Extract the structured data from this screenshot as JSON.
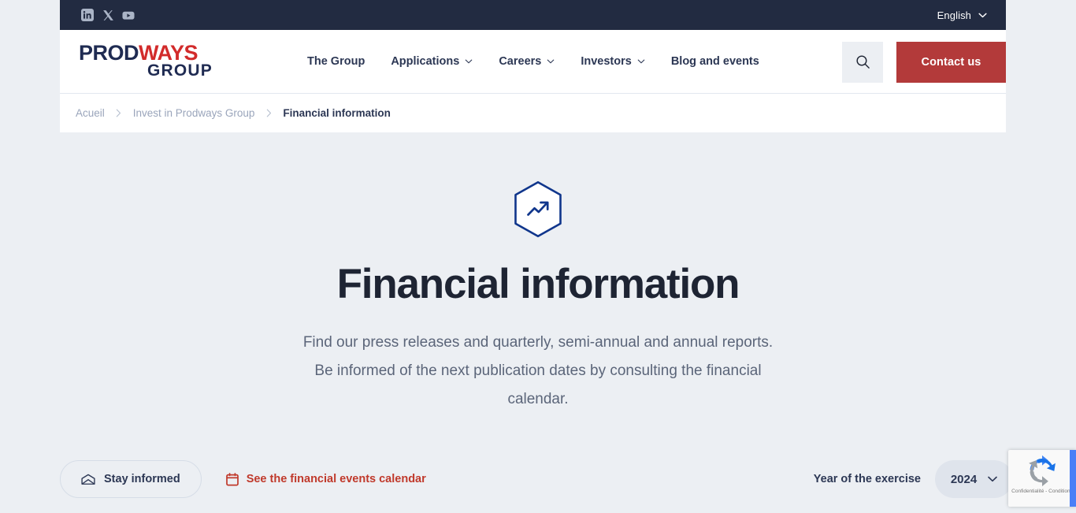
{
  "topbar": {
    "social": [
      {
        "name": "linkedin-icon",
        "label": "LinkedIn"
      },
      {
        "name": "x-twitter-icon",
        "label": "X"
      },
      {
        "name": "youtube-icon",
        "label": "YouTube"
      }
    ],
    "language": "English"
  },
  "header": {
    "logo": {
      "part1": "PROD",
      "part2": "WAYS",
      "part3": "GROUP"
    },
    "nav": [
      {
        "label": "The Group",
        "has_dropdown": false
      },
      {
        "label": "Applications",
        "has_dropdown": true
      },
      {
        "label": "Careers",
        "has_dropdown": true
      },
      {
        "label": "Investors",
        "has_dropdown": true
      },
      {
        "label": "Blog and events",
        "has_dropdown": false
      }
    ],
    "search_icon": "search-icon",
    "contact_label": "Contact us"
  },
  "breadcrumb": {
    "items": [
      {
        "label": "Acueil",
        "current": false
      },
      {
        "label": "Invest in Prodways Group",
        "current": false
      },
      {
        "label": "Financial information",
        "current": true
      }
    ]
  },
  "hero": {
    "icon": "trending-up-hexagon-icon",
    "title": "Financial information",
    "description": "Find our press releases and quarterly, semi-annual and annual reports. Be informed of the next publication dates by consulting the financial calendar."
  },
  "controls": {
    "stay_informed_label": "Stay informed",
    "stay_informed_icon": "envelope-open-icon",
    "calendar_link_label": "See the financial events calendar",
    "calendar_icon": "calendar-icon",
    "year_label": "Year of the exercise",
    "year_value": "2024",
    "year_options": [
      "2024"
    ]
  },
  "recaptcha": {
    "text": "Confidentialité - Conditions"
  },
  "colors": {
    "page_bg": "#eceff3",
    "topbar_bg": "#222b41",
    "accent_red": "#b33a3a",
    "link_red": "#c0392b",
    "logo_navy": "#1f2b52",
    "logo_red": "#d22b2b",
    "hex_blue": "#10368c",
    "title_dark": "#1e2433",
    "body_text": "#5b6579"
  }
}
